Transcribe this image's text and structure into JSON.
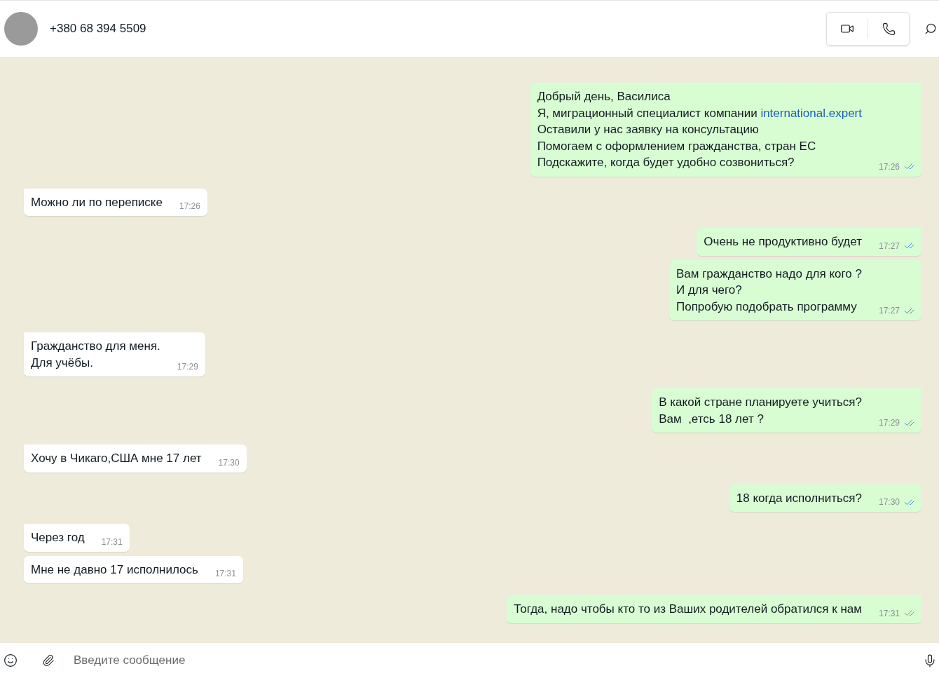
{
  "header": {
    "contact": "+380 68 394 5509"
  },
  "messages": [
    {
      "kind": "outgoing",
      "read": true,
      "time": "17:26",
      "lines": [
        {
          "text": "Добрый день, Василиса"
        },
        {
          "text": "Я, миграционный специалист компании ",
          "link": "international.expert"
        },
        {
          "text": "Оставили у нас заявку на консультацию"
        },
        {
          "text": "Помогаем с оформлением гражданства, стран ЕС"
        },
        {
          "text": "Подскажите, когда будет удобно созвониться?"
        }
      ]
    },
    {
      "kind": "incoming",
      "time": "17:26",
      "lines": [
        {
          "text": "Можно ли по переписке"
        }
      ]
    },
    {
      "kind": "outgoing",
      "read": true,
      "time": "17:27",
      "lines": [
        {
          "text": "Очень не продуктивно будет"
        }
      ]
    },
    {
      "kind": "outgoing",
      "read": true,
      "time": "17:27",
      "lines": [
        {
          "text": "Вам гражданство надо для кого ?"
        },
        {
          "text": "И для чего?"
        },
        {
          "text": "Попробую подобрать программу"
        }
      ]
    },
    {
      "kind": "incoming",
      "time": "17:29",
      "lines": [
        {
          "text": "Гражданство для меня."
        },
        {
          "text": "Для учёбы."
        }
      ]
    },
    {
      "kind": "outgoing",
      "read": true,
      "time": "17:29",
      "lines": [
        {
          "text": "В какой стране планируете учиться?"
        },
        {
          "text": "Вам  ,етсь 18 лет ?"
        }
      ]
    },
    {
      "kind": "incoming",
      "time": "17:30",
      "lines": [
        {
          "text": "Хочу в Чикаго,США мне 17 лет"
        }
      ]
    },
    {
      "kind": "outgoing",
      "read": true,
      "time": "17:30",
      "lines": [
        {
          "text": "18 когда исполниться?"
        }
      ]
    },
    {
      "kind": "incoming",
      "time": "17:31",
      "lines": [
        {
          "text": "Через год"
        }
      ]
    },
    {
      "kind": "incoming",
      "time": "17:31",
      "lines": [
        {
          "text": "Мне не давно 17 исполнилось"
        }
      ]
    },
    {
      "kind": "outgoing",
      "read": false,
      "time": "17:31",
      "lines": [
        {
          "text": "Тогда, надо чтобы кто то из Ваших родителей обратился к нам"
        }
      ]
    }
  ],
  "composer": {
    "placeholder": "Введите сообщение"
  }
}
